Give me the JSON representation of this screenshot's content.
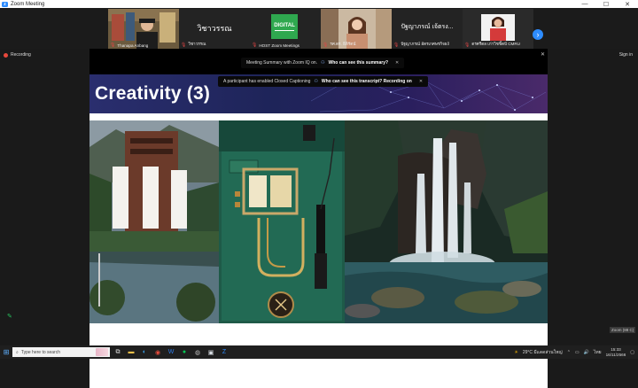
{
  "window": {
    "title": "Zoom Meeting",
    "controls": [
      "—",
      "☐",
      "✕"
    ]
  },
  "gallery": {
    "tiles": [
      {
        "name": "Thanapa Anbang",
        "type": "video"
      },
      {
        "name": "วิชาวรรณ",
        "display": "วิชาวรรณ",
        "type": "name"
      },
      {
        "name": "HOST Zoom Meetings",
        "logo_text": "DIGITAL",
        "type": "logo"
      },
      {
        "name": "รศ.ดร. ธิติรัตน์",
        "type": "video"
      },
      {
        "name": "ปัฐญาภรณ์ อัตรเกศษรกิจธง์",
        "display": "ปัฐญาภรณ์ เจ้ตรง...",
        "type": "name"
      },
      {
        "name": "ดรศรีดล เก่าวิชชิ้ตปั CMRU",
        "type": "video"
      }
    ],
    "next_icon": "chevron-right-icon"
  },
  "status": {
    "recording": "Recording",
    "signin": "Sign in"
  },
  "notices": {
    "summary": {
      "text": "Meeting Summary with Zoom IQ on.",
      "link": "Who can see this summary?"
    },
    "captions": {
      "text": "A participant has enabled Closed Captioning",
      "link": "Who can see this transcript? Recording on"
    }
  },
  "slide": {
    "title": "Creativity (3)"
  },
  "taskbar": {
    "search_placeholder": "Type here to search",
    "weather": "29°C  มีแดดส่วนใหญ่",
    "lang": "ไทย",
    "time": "15:33",
    "date": "16/11/2566"
  },
  "hint": "Zoom (88 C)",
  "colors": {
    "zoom_blue": "#2d8cff",
    "recording_red": "#e8483c",
    "mic_red": "#e54545"
  }
}
